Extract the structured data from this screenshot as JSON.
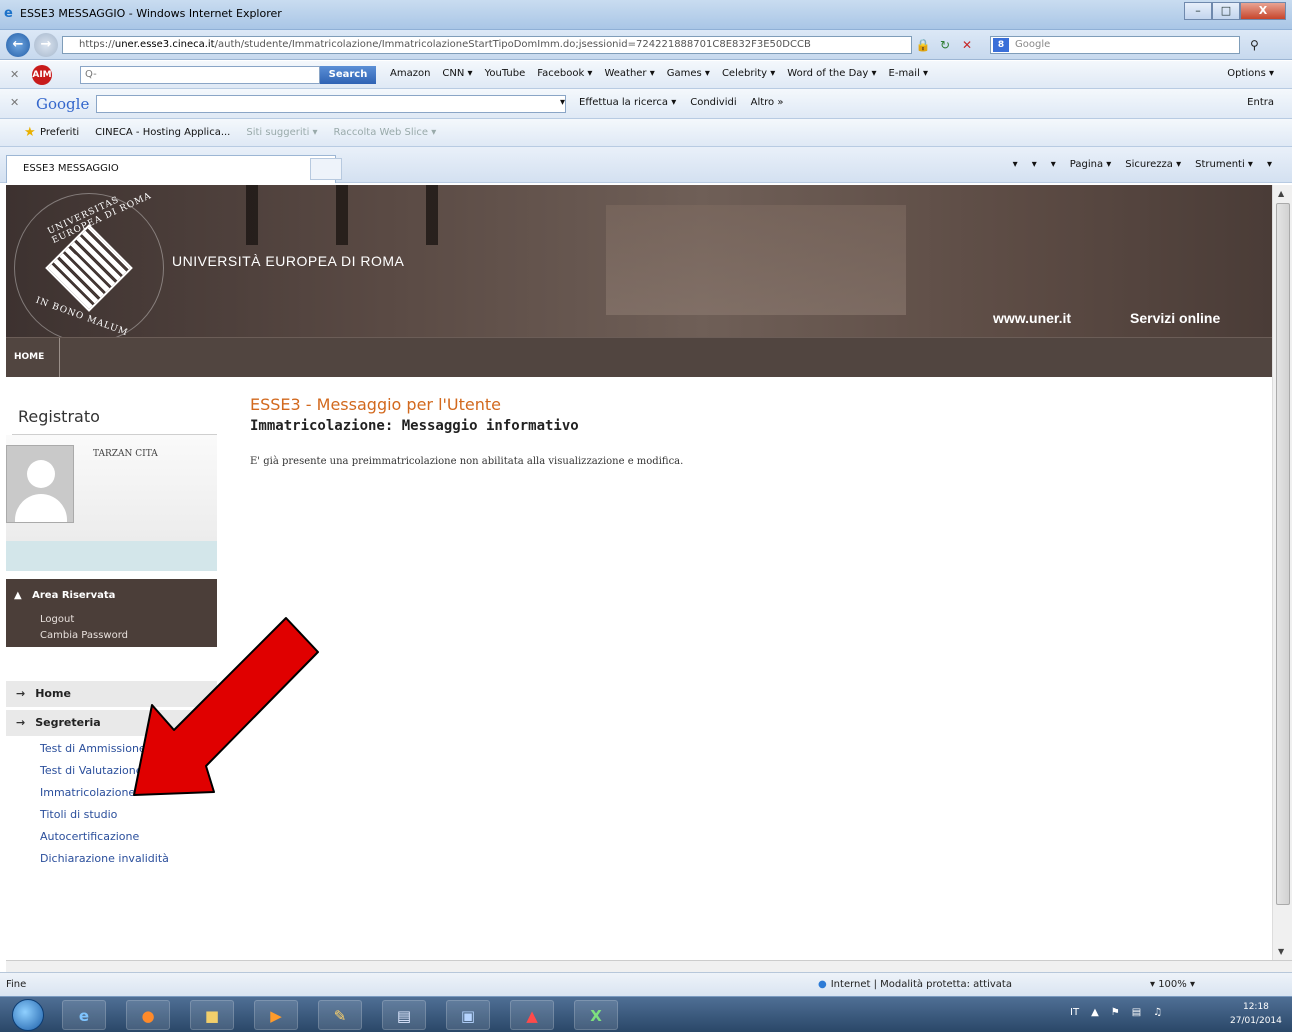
{
  "window": {
    "title": "ESSE3 MESSAGGIO - Windows Internet Explorer",
    "min": "–",
    "max": "□",
    "close": "X"
  },
  "address": {
    "prefix": "https://",
    "domain": "uner.esse3.cineca.it",
    "path": "/auth/studente/Immatricolazione/ImmatricolazioneStartTipoDomImm.do;jsessionid=724221888701C8E832F3E50DCCB",
    "search_placeholder": "Google"
  },
  "toolbar1": {
    "search_placeholder": "Q-",
    "search_button": "Search",
    "items": [
      "Amazon",
      "CNN ▾",
      "YouTube",
      "Facebook ▾",
      "Weather ▾",
      "Games ▾",
      "Celebrity ▾",
      "Word of the Day ▾",
      "E-mail ▾"
    ],
    "options": "Options ▾"
  },
  "toolbar2": {
    "logo": "Google",
    "items": [
      "▾",
      "Effettua la ricerca ▾",
      "Condividi",
      "Altro »"
    ],
    "right": "Entra"
  },
  "favorites": {
    "label": "Preferiti",
    "items": [
      "CINECA - Hosting Applica...",
      "Siti suggeriti ▾",
      "Raccolta Web Slice ▾"
    ]
  },
  "tab": {
    "label": "ESSE3 MESSAGGIO"
  },
  "commandbar": [
    "▾",
    "▾",
    "▾",
    "Pagina ▾",
    "Sicurezza ▾",
    "Strumenti ▾",
    "▾"
  ],
  "banner": {
    "seal_top": "UNIVERSITAS EUROPEA DI ROMA",
    "seal_bottom": "IN BONO MALUM",
    "university": "UNIVERSITÀ EUROPEA DI ROMA",
    "site_link": "www.uner.it",
    "services_link": "Servizi online"
  },
  "menu": {
    "home": "HOME"
  },
  "sidebar": {
    "title": "Registrato",
    "user": "TARZAN CITA",
    "reserved_header": "Area Riservata",
    "logout": "Logout",
    "change_password": "Cambia Password",
    "home": "Home",
    "secretary": "Segreteria",
    "links": [
      "Test di Ammissione",
      "Test di Valutazione",
      "Immatricolazione",
      "Titoli di studio",
      "Autocertificazione",
      "Dichiarazione invalidità"
    ]
  },
  "main": {
    "title": "ESSE3 - Messaggio per l'Utente",
    "subtitle": "Immatricolazione: Messaggio informativo",
    "message": "E' già presente una preimmatricolazione non abilitata alla visualizzazione e modifica."
  },
  "status": {
    "left": "Fine",
    "zone": "Internet | Modalità protetta: attivata",
    "zoom": "▾   100%  ▾"
  },
  "taskbar": {
    "lang": "IT",
    "time": "12:18",
    "date": "27/01/2014"
  },
  "colors": {
    "accent_title": "#d2691e",
    "link": "#2b4f9c",
    "banner": "#514540",
    "annotation_arrow": "#e00000"
  }
}
